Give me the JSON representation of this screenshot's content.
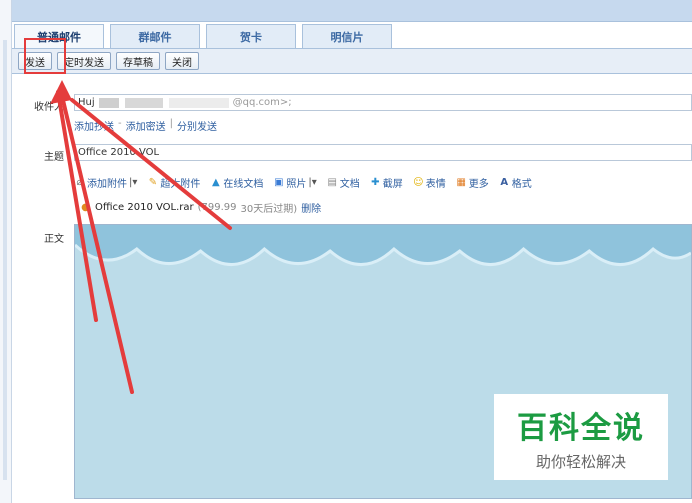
{
  "tabs": [
    {
      "label": "普通邮件",
      "active": true
    },
    {
      "label": "群邮件",
      "active": false
    },
    {
      "label": "贺卡",
      "active": false
    },
    {
      "label": "明信片",
      "active": false
    }
  ],
  "toolbar": {
    "send_label": "发送",
    "scheduled_label": "定时发送",
    "draft_label": "存草稿",
    "close_label": "关闭"
  },
  "compose": {
    "to_label": "收件人",
    "to_value_prefix": "Huj",
    "to_value_suffix": "@qq.com>;",
    "links": [
      "添加抄送",
      "添加密送",
      "分别发送"
    ],
    "subject_label": "主题",
    "subject_value": "Office 2010 VOL",
    "attach_actions": [
      {
        "label": "添加附件",
        "icon": "paperclip-icon"
      },
      {
        "label": "超大附件",
        "icon": "big-attach-icon"
      },
      {
        "label": "在线文档",
        "icon": "cloud-doc-icon"
      },
      {
        "label": "照片",
        "icon": "photo-icon"
      },
      {
        "label": "文档",
        "icon": "doc-icon"
      },
      {
        "label": "截屏",
        "icon": "screenshot-icon"
      },
      {
        "label": "表情",
        "icon": "emoji-icon"
      },
      {
        "label": "更多",
        "icon": "more-icon"
      },
      {
        "label": "格式",
        "icon": "format-icon"
      }
    ],
    "attachment": {
      "name": "Office 2010 VOL.rar",
      "size": "(799.99",
      "expiry": "30天后过期)",
      "delete_label": "删除"
    },
    "body_label": "正文"
  },
  "watermark": {
    "title": "百科全说",
    "subtitle": "助你轻松解决"
  },
  "colors": {
    "accent": "#2f5fa0",
    "highlight": "#e43c3c",
    "watermark_green": "#1c9b42",
    "editor_bg": "#bcdce9"
  }
}
